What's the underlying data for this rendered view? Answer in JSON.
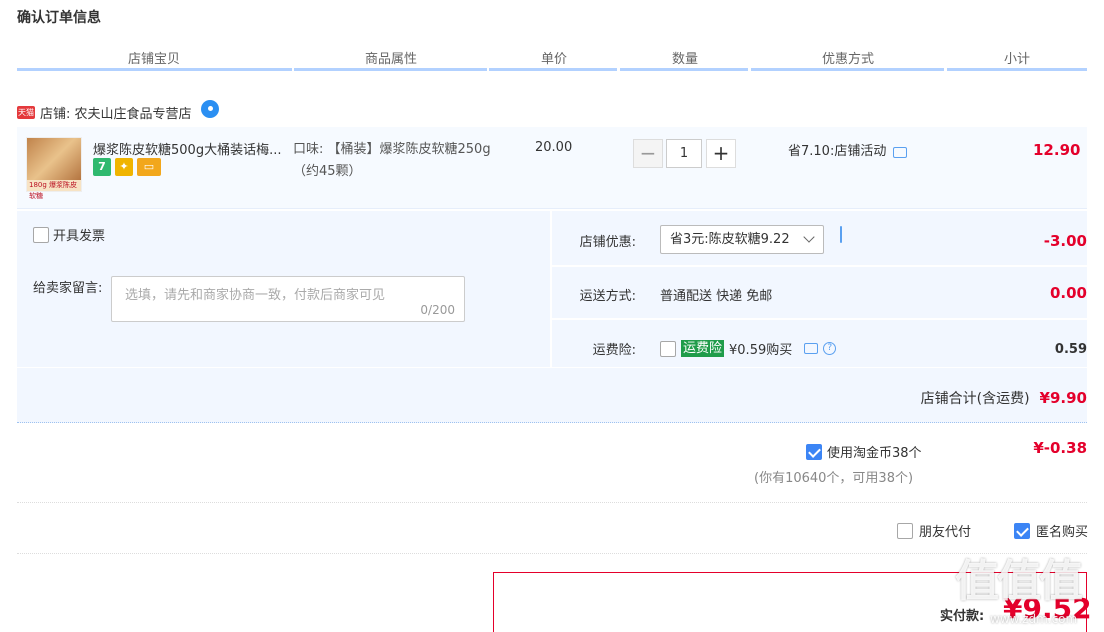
{
  "page_title": "确认订单信息",
  "columns": [
    "店铺宝贝",
    "商品属性",
    "单价",
    "数量",
    "优惠方式",
    "小计"
  ],
  "shop": {
    "badge": "天猫",
    "label": "店铺: 农夫山庄食品专营店"
  },
  "item": {
    "name": "爆浆陈皮软糖500g大桶装话梅...",
    "thumb_caption": "180g 爆浆陈皮软糖",
    "badge_7": "7",
    "attribute": "口味: 【桶装】爆浆陈皮软糖250g（约45颗）",
    "unit_price": "20.00",
    "quantity": "1",
    "minus": "−",
    "plus": "+",
    "promotion": "省7.10:店铺活动",
    "subtotal": "12.90"
  },
  "invoice_label": "开具发票",
  "message": {
    "label": "给卖家留言:",
    "placeholder": "选填，请先和商家协商一致，付款后商家可见",
    "counter": "0/200"
  },
  "shop_discount": {
    "label": "店铺优惠:",
    "selected": "省3元:陈皮软糖9.22",
    "value": "-3.00"
  },
  "shipping": {
    "label": "运送方式:",
    "value_text": "普通配送 快递 免邮",
    "value": "0.00"
  },
  "insurance": {
    "label": "运费险:",
    "badge": "运费险",
    "price_text": "¥0.59购买",
    "qmark": "?",
    "value": "0.59"
  },
  "shop_total": {
    "label": "店铺合计(含运费)",
    "value": "¥9.90"
  },
  "coins": {
    "label": "使用淘金币38个",
    "value": "¥-0.38",
    "note": "(你有10640个，可用38个)"
  },
  "friend_pay": "朋友代付",
  "anonymous": "匿名购买",
  "pay": {
    "label": "实付款:",
    "value": "¥9.52"
  },
  "watermark": {
    "text": "值值值",
    "site": "www.zdm.com"
  },
  "colors": {
    "accent_red": "#e4002b",
    "accent_blue": "#3c85f5",
    "panel_bg": "#f2f7ff"
  }
}
